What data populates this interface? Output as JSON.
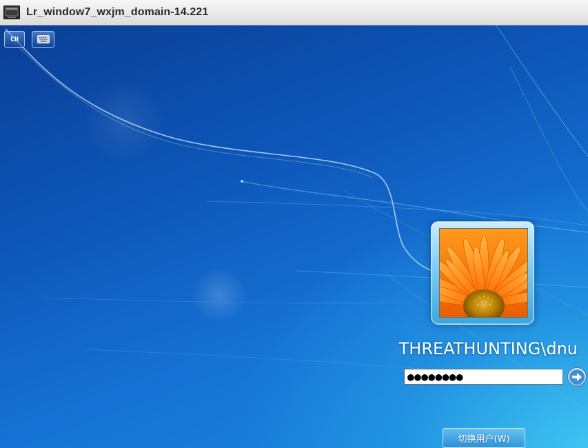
{
  "window": {
    "title": "Lr_window7_wxjm_domain-14.221",
    "icon": "monitor-icon"
  },
  "toolbar": {
    "language_label": "CH",
    "language_icon": "language-indicator-icon",
    "keyboard_icon": "on-screen-keyboard-icon"
  },
  "login": {
    "username": "THREATHUNTING\\dnu",
    "avatar_icon": "flower-avatar-icon",
    "password_value": "●●●●●●●●",
    "submit_icon": "arrow-right-icon",
    "switch_user_label": "切换用户(W)"
  },
  "colors": {
    "desktop_dark": "#0a3f96",
    "desktop_light": "#3fc6f2",
    "flower_orange": "#ff7b00",
    "flower_center": "#c58a00"
  }
}
